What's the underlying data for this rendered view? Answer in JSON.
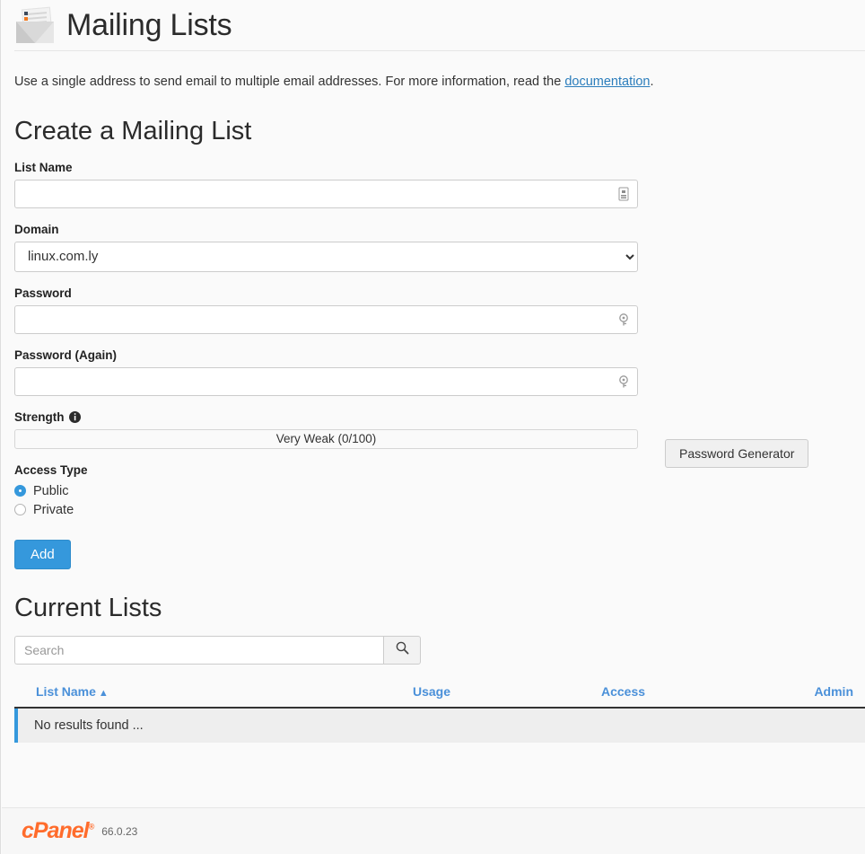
{
  "header": {
    "title": "Mailing Lists",
    "icon": "mailing-list-envelope-icon"
  },
  "description": {
    "text_before": "Use a single address to send email to multiple email addresses. For more information, read the ",
    "link_label": "documentation",
    "text_after": "."
  },
  "create_section": {
    "title": "Create a Mailing List",
    "list_name": {
      "label": "List Name",
      "value": "",
      "placeholder": "",
      "icon": "text-field-indicator-icon"
    },
    "domain": {
      "label": "Domain",
      "selected": "linux.com.ly",
      "options": [
        "linux.com.ly"
      ]
    },
    "password": {
      "label": "Password",
      "value": "",
      "placeholder": "",
      "icon": "key-icon"
    },
    "password_again": {
      "label": "Password (Again)",
      "value": "",
      "placeholder": "",
      "icon": "key-icon"
    },
    "strength": {
      "label": "Strength",
      "info_icon": "info-icon",
      "value_text": "Very Weak (0/100)",
      "score": 0,
      "max": 100,
      "generator_button": "Password Generator"
    },
    "access_type": {
      "label": "Access Type",
      "options": [
        {
          "label": "Public",
          "selected": true
        },
        {
          "label": "Private",
          "selected": false
        }
      ]
    },
    "submit_button": "Add"
  },
  "current_section": {
    "title": "Current Lists",
    "search": {
      "placeholder": "Search",
      "value": "",
      "button_icon": "search-icon"
    },
    "table": {
      "columns": [
        {
          "label": "List Name",
          "sort": "ascending",
          "sort_caret": "▲"
        },
        {
          "label": "Usage",
          "sort": "none",
          "sort_caret": ""
        },
        {
          "label": "Access",
          "sort": "none",
          "sort_caret": ""
        },
        {
          "label": "Admin",
          "sort": "none",
          "sort_caret": ""
        }
      ],
      "rows": [],
      "empty_message": "No results found ..."
    }
  },
  "footer": {
    "logo_text": "cPanel",
    "logo_mark": "®",
    "version": "66.0.23"
  },
  "colors": {
    "accent_blue": "#3598dc",
    "link_blue": "#2b7dbc",
    "header_link_blue": "#4a90d9",
    "cpanel_orange": "#ff6c2c",
    "page_bg": "#fafafa",
    "empty_row_bg": "#eeeeee"
  }
}
